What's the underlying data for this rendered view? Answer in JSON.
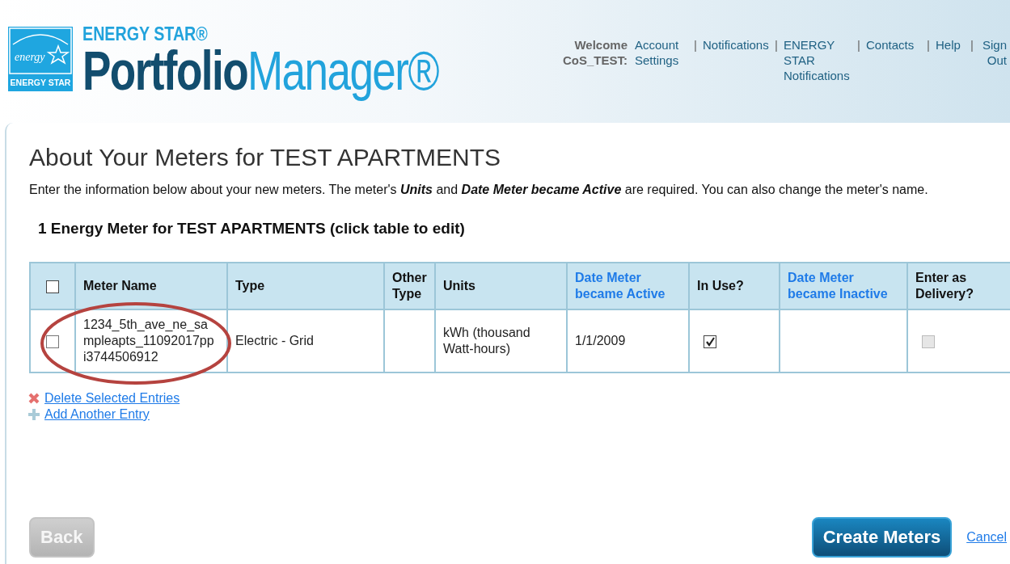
{
  "header": {
    "logo": {
      "script_word": "energy",
      "badge_label": "ENERGY STAR",
      "brand_line": "ENERGY STAR®",
      "product_bold": "Portfolio",
      "product_light": "Manager®"
    },
    "welcome": "Welcome CoS_TEST:",
    "nav_links": [
      {
        "label": "Account Settings"
      },
      {
        "label": "Notifications"
      },
      {
        "label": "ENERGY STAR Notifications"
      },
      {
        "label": "Contacts"
      },
      {
        "label": "Help"
      },
      {
        "label": "Sign Out"
      }
    ],
    "separator": "|"
  },
  "page": {
    "title": "About Your Meters for TEST APARTMENTS",
    "intro": "Enter the information below about your new meters. The meter's **Units** and **Date Meter became Active** are required. You can also change the meter's name.",
    "section_title": "1 Energy Meter for TEST APARTMENTS (click table to edit)"
  },
  "table": {
    "select_all": {
      "checked": false
    },
    "columns": [
      {
        "label": "Meter Name",
        "kind": "plain"
      },
      {
        "label": "Type",
        "kind": "plain"
      },
      {
        "label": "Other Type",
        "kind": "plain"
      },
      {
        "label": "Units",
        "kind": "plain"
      },
      {
        "label": "Date Meter became Active",
        "kind": "link"
      },
      {
        "label": "In Use?",
        "kind": "plain"
      },
      {
        "label": "Date Meter became Inactive",
        "kind": "link"
      },
      {
        "label": "Enter as Delivery?",
        "kind": "plain"
      }
    ],
    "rows": [
      {
        "selected": false,
        "meter_name": "1234_5th_ave_ne_sampleapts_11092017ppi3744506912",
        "highlighted": true,
        "type": "Electric - Grid",
        "units": "kWh (thousand Watt-hours)",
        "date_active": "1/1/2009",
        "in_use": {
          "checked": true
        },
        "delivery": {
          "checked": false,
          "disabled": true
        }
      }
    ]
  },
  "actions": [
    {
      "label": "Delete Selected Entries",
      "kind": "delete"
    },
    {
      "label": "Add Another Entry",
      "kind": "add"
    }
  ],
  "footer": {
    "back": {
      "label": "Back",
      "disabled": true
    },
    "create": {
      "label": "Create Meters",
      "disabled": false
    },
    "cancel": "Cancel"
  }
}
